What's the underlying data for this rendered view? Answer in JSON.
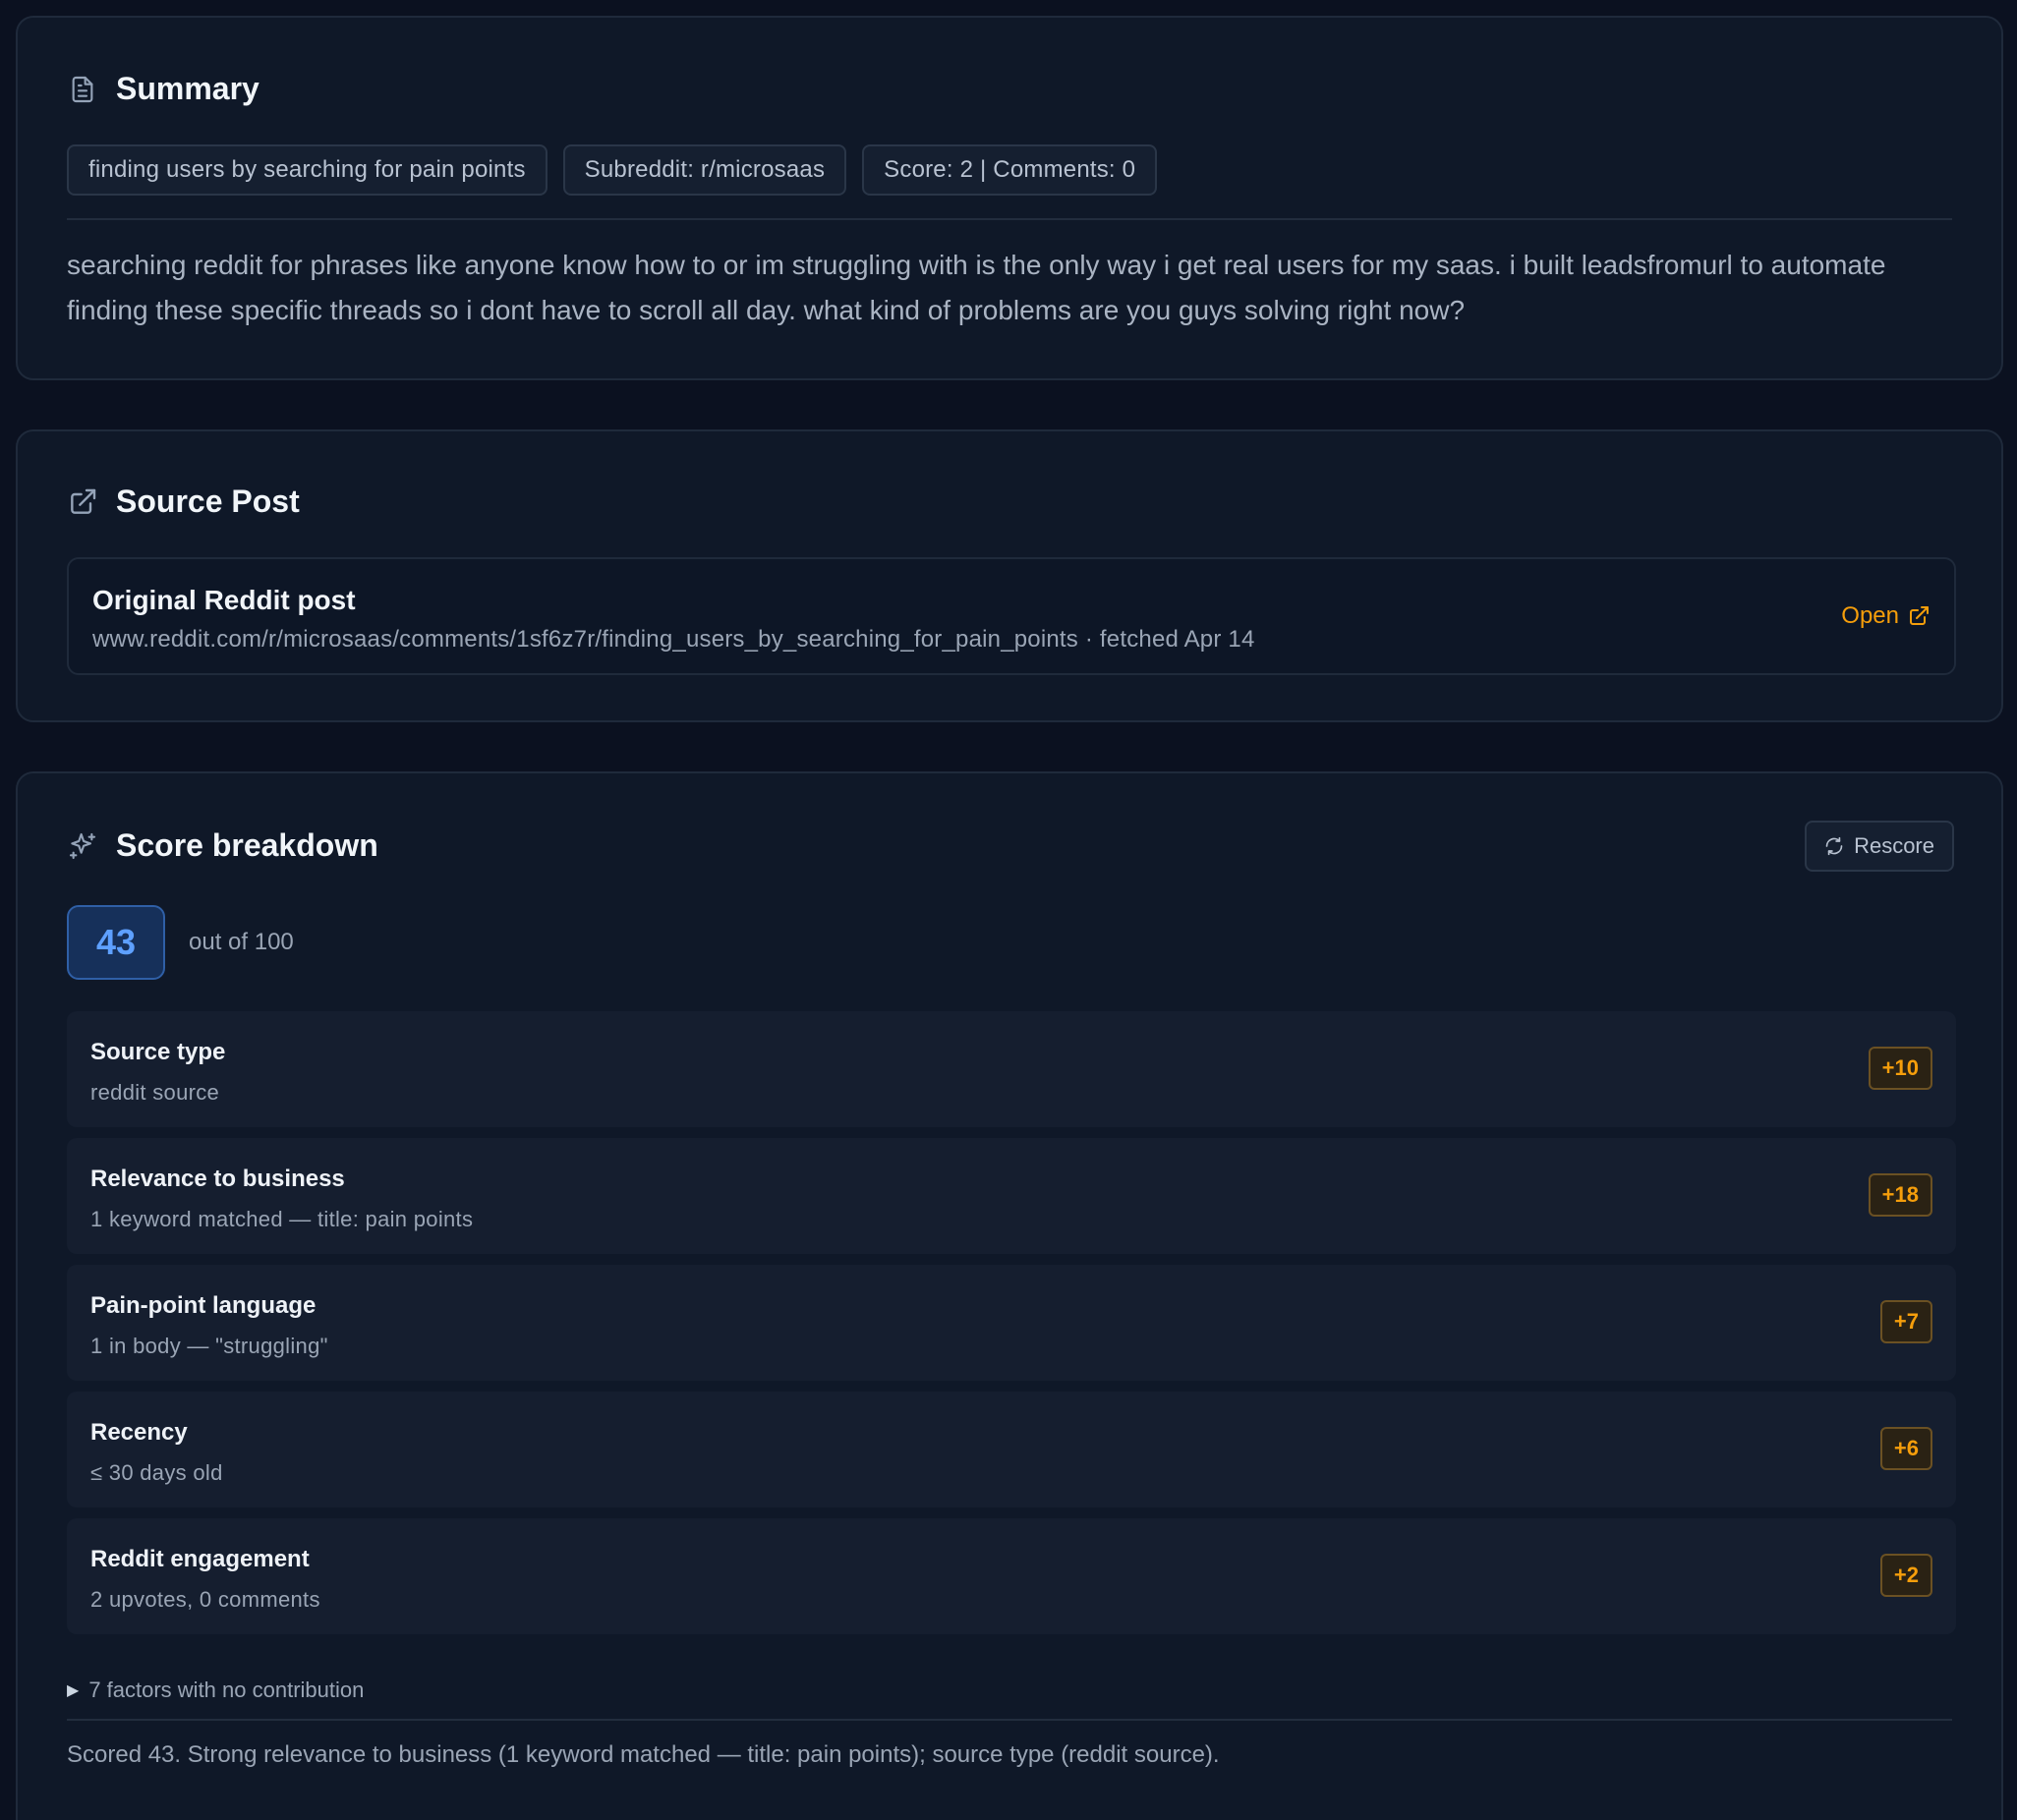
{
  "summary": {
    "title": "Summary",
    "icon": "document-icon",
    "tags": [
      "finding users by searching for pain points",
      "Subreddit: r/microsaas",
      "Score: 2 | Comments: 0"
    ],
    "body": "searching reddit for phrases like anyone know how to or im struggling with is the only way i get real users for my saas. i built leadsfromurl to automate finding these specific threads so i dont have to scroll all day. what kind of problems are you guys solving right now?"
  },
  "source": {
    "title": "Source Post",
    "icon": "external-link-icon",
    "post_title": "Original Reddit post",
    "url_line": "www.reddit.com/r/microsaas/comments/1sf6z7r/finding_users_by_searching_for_pain_points · fetched Apr 14",
    "open_label": "Open"
  },
  "score": {
    "title": "Score breakdown",
    "icon": "sparkles-icon",
    "rescore_label": "Rescore",
    "value": "43",
    "out_of": "out of 100",
    "factors": [
      {
        "name": "Source type",
        "desc": "reddit source",
        "points": "+10"
      },
      {
        "name": "Relevance to business",
        "desc": "1 keyword matched — title: pain points",
        "points": "+18"
      },
      {
        "name": "Pain-point language",
        "desc": "1 in body — \"struggling\"",
        "points": "+7"
      },
      {
        "name": "Recency",
        "desc": "≤ 30 days old",
        "points": "+6"
      },
      {
        "name": "Reddit engagement",
        "desc": "2 upvotes, 0 comments",
        "points": "+2"
      }
    ],
    "no_contribution": "7 factors with no contribution",
    "footer": "Scored 43. Strong relevance to business (1 keyword matched — title: pain points); source type (reddit source)."
  },
  "colors": {
    "background": "#0b1120",
    "card": "#0f1828",
    "accent_orange": "#f59e0b",
    "accent_blue": "#5ea0ff"
  }
}
